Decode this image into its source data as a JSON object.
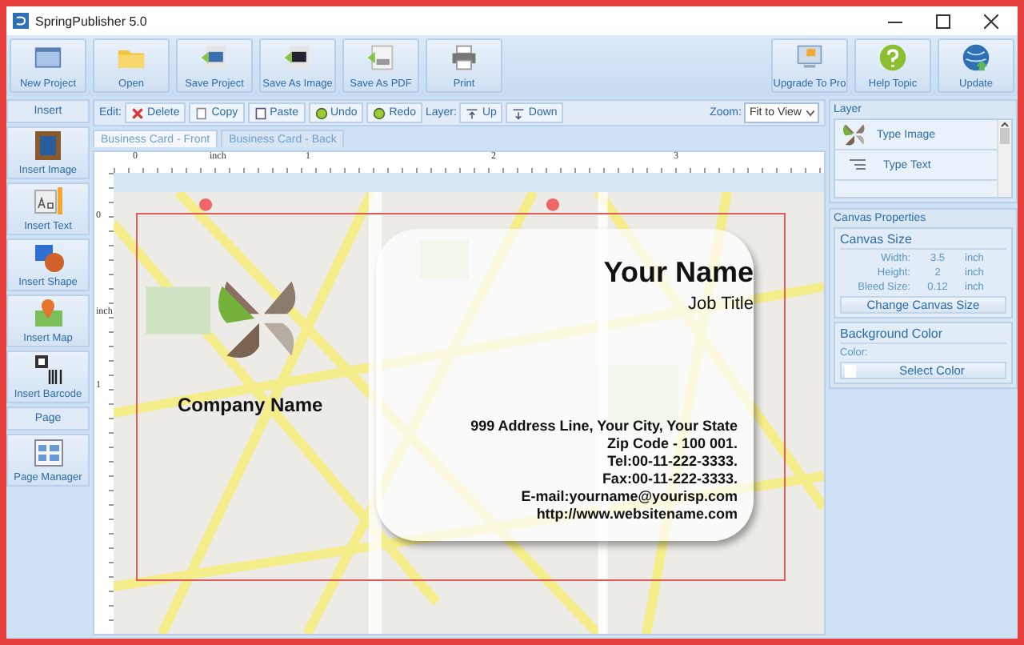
{
  "window": {
    "title": "SpringPublisher 5.0"
  },
  "toolbar": {
    "left": [
      {
        "label": "New Project"
      },
      {
        "label": "Open"
      },
      {
        "label": "Save Project"
      },
      {
        "label": "Save As Image"
      },
      {
        "label": "Save As PDF"
      },
      {
        "label": "Print"
      }
    ],
    "right": [
      {
        "label": "Upgrade To Pro"
      },
      {
        "label": "Help Topic"
      },
      {
        "label": "Update"
      }
    ]
  },
  "edit_bar": {
    "edit_label": "Edit:",
    "edit_actions": [
      {
        "label": "Delete"
      },
      {
        "label": "Copy"
      },
      {
        "label": "Paste"
      },
      {
        "label": "Undo"
      },
      {
        "label": "Redo"
      }
    ],
    "layer_label": "Layer:",
    "layer_actions": [
      {
        "label": "Up"
      },
      {
        "label": "Down"
      }
    ],
    "zoom_label": "Zoom:",
    "zoom_value": "Fit to View"
  },
  "tabs": [
    {
      "label": "Business Card - Front",
      "selected": true
    },
    {
      "label": "Business Card - Back",
      "selected": false
    }
  ],
  "ruler": {
    "horizontal": [
      "0",
      "inch",
      "1",
      "2",
      "3"
    ],
    "vertical": [
      "0",
      "inch",
      "1"
    ]
  },
  "card": {
    "company_name": "Company Name",
    "name": "Your Name",
    "job_title": "Job Title",
    "contact_lines": [
      "999 Address Line, Your City, Your State",
      "Zip Code - 100 001.",
      "Tel:00-11-222-3333.",
      "Fax:00-11-222-3333.",
      "E-mail:yourname@yourisp.com",
      "http://www.websitename.com"
    ]
  },
  "sidebar": {
    "insert_heading": "Insert",
    "insert_items": [
      {
        "label": "Insert Image"
      },
      {
        "label": "Insert Text"
      },
      {
        "label": "Insert Shape"
      },
      {
        "label": "Insert Map"
      },
      {
        "label": "Insert Barcode"
      }
    ],
    "page_heading": "Page",
    "page_items": [
      {
        "label": "Page Manager"
      }
    ]
  },
  "layer_panel": {
    "title": "Layer",
    "items": [
      {
        "label": "Type Image"
      },
      {
        "label": "Type Text"
      }
    ]
  },
  "canvas_properties": {
    "title": "Canvas Properties",
    "canvas_size": {
      "title": "Canvas Size",
      "fields": [
        {
          "label": "Width:",
          "value": "3.5",
          "unit": "inch"
        },
        {
          "label": "Height:",
          "value": "2",
          "unit": "inch"
        },
        {
          "label": "Bleed Size:",
          "value": "0.12",
          "unit": "inch"
        }
      ],
      "button": "Change Canvas Size"
    },
    "background_color": {
      "title": "Background Color",
      "color_label": "Color:",
      "button": "Select Color"
    }
  }
}
